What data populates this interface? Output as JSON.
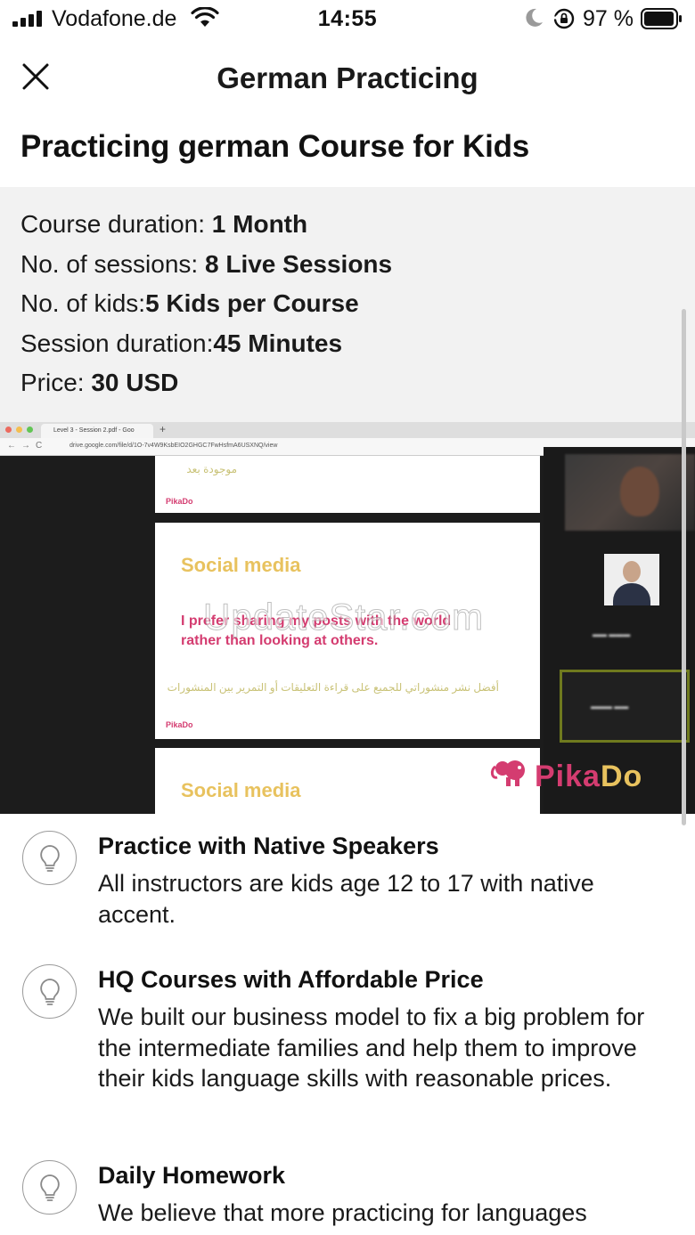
{
  "status_bar": {
    "carrier": "Vodafone.de",
    "time": "14:55",
    "battery_percent": "97 %"
  },
  "header": {
    "title": "German Practicing",
    "close_icon": "close-icon"
  },
  "course": {
    "title": "Practicing german Course for Kids",
    "details": [
      {
        "label": "Course duration: ",
        "value": "1 Month"
      },
      {
        "label": "No. of sessions: ",
        "value": "8 Live Sessions"
      },
      {
        "label": "No. of kids:",
        "value": "5 Kids per Course"
      },
      {
        "label": "Session duration:",
        "value": "45 Minutes"
      },
      {
        "label": "Price: ",
        "value": "30 USD"
      }
    ]
  },
  "media": {
    "browser_tab": "Level 3 - Session 2.pdf - Goo",
    "url": "drive.google.com/file/d/1O-7v4W9KsbEIO2GHGC7FwHsfmA6USXNQ/view",
    "slide_top_arabic": "موجودة بعد",
    "slide_top_logo": "PikaDo",
    "slide_heading": "Social media",
    "slide_sentence_1": "I prefer sharing my posts with the world",
    "slide_sentence_2": "rather than looking at others.",
    "slide_arabic": "أفضل نشر منشوراتي للجميع على قراءة التعليقات أو التمرير بين المنشورات",
    "slide_logo": "PikaDo",
    "slide_bottom_heading": "Social media",
    "logo_text": "PikaDo",
    "watermark": "UpdateStar.com",
    "colors": {
      "slide_heading": "#e8c25e",
      "slide_body": "#d43c70",
      "logo_pink": "#d43c70",
      "logo_gold": "#e8c25e",
      "active_speaker_border": "#6f7a1e"
    }
  },
  "features": [
    {
      "icon": "lightbulb-icon",
      "title": "Practice with Native Speakers",
      "description": "All instructors are kids age 12 to 17 with native accent."
    },
    {
      "icon": "lightbulb-icon",
      "title": "HQ Courses with Affordable Price",
      "description": "We built our business model to fix a big problem for the intermediate families and help them to improve their kids language skills with reasonable prices."
    },
    {
      "icon": "lightbulb-icon",
      "title": "Daily Homework",
      "description": "We believe that more practicing for languages"
    }
  ]
}
